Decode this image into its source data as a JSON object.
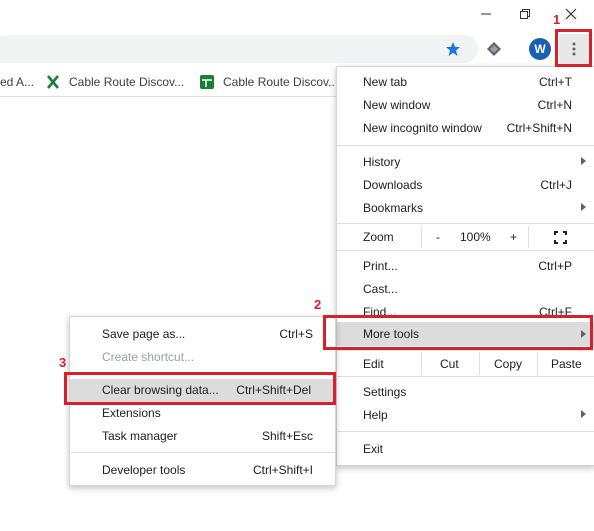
{
  "window": {
    "minimize_icon": "minimize-icon",
    "restore_icon": "restore-icon",
    "close_icon": "close-icon"
  },
  "toolbar": {
    "avatar_letter": "W"
  },
  "bookmarks": [
    {
      "label": "ed A..."
    },
    {
      "label": "Cable Route Discov..."
    },
    {
      "label": "Cable Route Discov..."
    }
  ],
  "main_menu": {
    "new_tab": {
      "label": "New tab",
      "shortcut": "Ctrl+T"
    },
    "new_window": {
      "label": "New window",
      "shortcut": "Ctrl+N"
    },
    "new_incognito": {
      "label": "New incognito window",
      "shortcut": "Ctrl+Shift+N"
    },
    "history": {
      "label": "History"
    },
    "downloads": {
      "label": "Downloads",
      "shortcut": "Ctrl+J"
    },
    "bookmarks": {
      "label": "Bookmarks"
    },
    "zoom": {
      "label": "Zoom",
      "minus": "-",
      "value": "100%",
      "plus": "+"
    },
    "print": {
      "label": "Print...",
      "shortcut": "Ctrl+P"
    },
    "cast": {
      "label": "Cast..."
    },
    "find": {
      "label": "Find...",
      "shortcut": "Ctrl+F"
    },
    "more_tools": {
      "label": "More tools"
    },
    "edit": {
      "label": "Edit",
      "cut": "Cut",
      "copy": "Copy",
      "paste": "Paste"
    },
    "settings": {
      "label": "Settings"
    },
    "help": {
      "label": "Help"
    },
    "exit": {
      "label": "Exit"
    }
  },
  "submenu": {
    "save_page": {
      "label": "Save page as...",
      "shortcut": "Ctrl+S"
    },
    "create_shortcut": {
      "label": "Create shortcut..."
    },
    "clear_browsing": {
      "label": "Clear browsing data...",
      "shortcut": "Ctrl+Shift+Del"
    },
    "extensions": {
      "label": "Extensions"
    },
    "task_manager": {
      "label": "Task manager",
      "shortcut": "Shift+Esc"
    },
    "developer_tools": {
      "label": "Developer tools",
      "shortcut": "Ctrl+Shift+I"
    }
  },
  "steps": [
    "1",
    "2",
    "3"
  ],
  "colors": {
    "annotation_red": "#d7202a",
    "star_blue": "#1a73e8",
    "avatar_bg": "#1a5fb4",
    "sheets_green": "#188038"
  }
}
